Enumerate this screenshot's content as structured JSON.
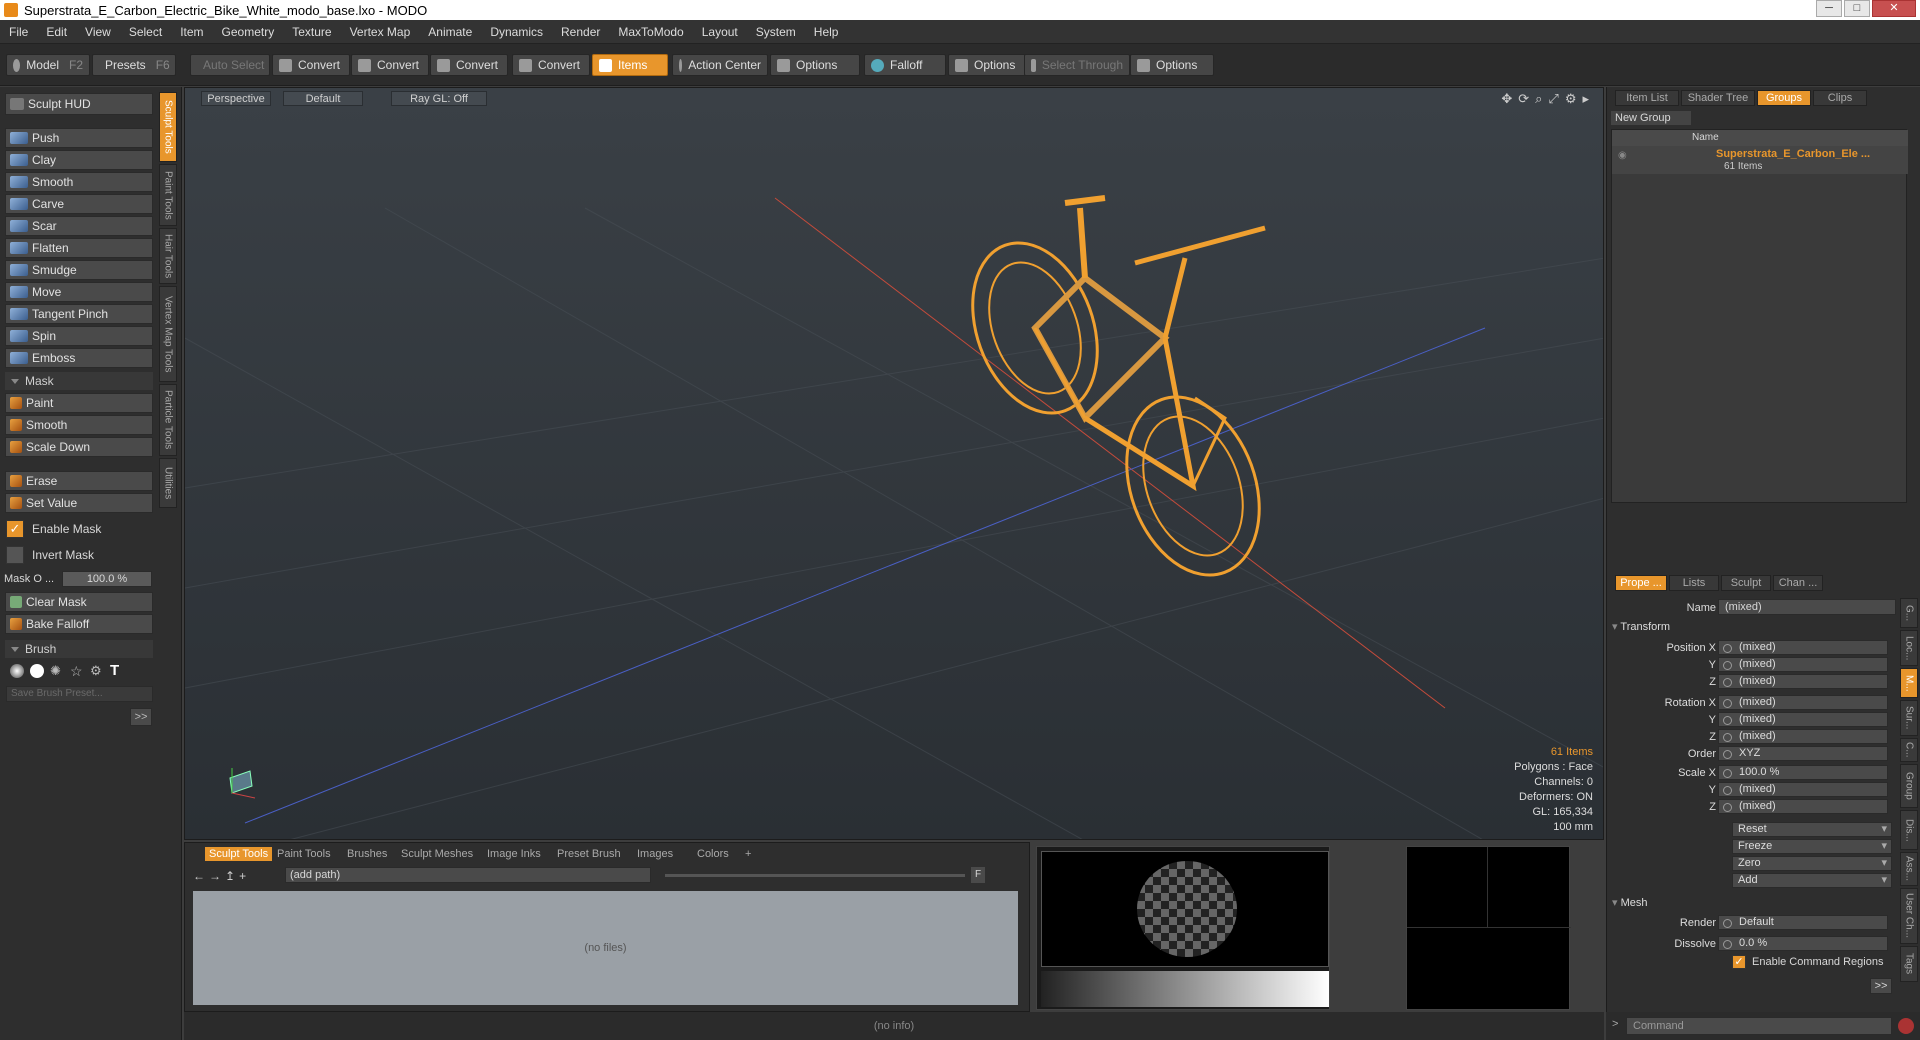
{
  "window": {
    "title": "Superstrata_E_Carbon_Electric_Bike_White_modo_base.lxo - MODO",
    "min": "─",
    "max": "□",
    "close": "✕"
  },
  "menu": [
    "File",
    "Edit",
    "View",
    "Select",
    "Item",
    "Geometry",
    "Texture",
    "Vertex Map",
    "Animate",
    "Dynamics",
    "Render",
    "MaxToModo",
    "Layout",
    "System",
    "Help"
  ],
  "toolbar": {
    "model": "Model",
    "model_key": "F2",
    "presets": "Presets",
    "presets_key": "F6",
    "auto_select": "Auto Select",
    "convert1": "Convert",
    "convert2": "Convert",
    "convert3": "Convert",
    "convert4": "Convert",
    "items": "Items",
    "action_center": "Action Center",
    "options1": "Options",
    "falloff": "Falloff",
    "options2": "Options",
    "select_through": "Select Through",
    "options3": "Options"
  },
  "left": {
    "sculpt_hud": "Sculpt HUD",
    "tools": [
      "Push",
      "Clay",
      "Smooth",
      "Carve",
      "Scar",
      "Flatten",
      "Smudge",
      "Move",
      "Tangent Pinch",
      "Spin",
      "Emboss"
    ],
    "mask_head": "Mask",
    "mask_tools": [
      "Paint",
      "Smooth",
      "Scale Down"
    ],
    "erase": "Erase",
    "set_value": "Set Value",
    "enable_mask": "Enable Mask",
    "invert_mask": "Invert Mask",
    "mask_opacity_label": "Mask O ...",
    "mask_opacity": "100.0 %",
    "clear_mask": "Clear Mask",
    "bake_falloff": "Bake Falloff",
    "brush_head": "Brush",
    "save_brush": "Save Brush Preset...",
    "more": ">>"
  },
  "vtabs": [
    "Sculpt Tools",
    "Paint Tools",
    "Hair Tools",
    "Vertex Map Tools",
    "Particle Tools",
    "Utilities"
  ],
  "viewport": {
    "perspective": "Perspective",
    "default": "Default",
    "raygl": "Ray GL: Off",
    "stats": {
      "items": "61 Items",
      "polygons": "Polygons : Face",
      "channels": "Channels: 0",
      "deformers": "Deformers: ON",
      "gl": "GL: 165,334",
      "scale": "100 mm"
    }
  },
  "right": {
    "tabs": [
      "Item List",
      "Shader Tree",
      "Groups",
      "Clips"
    ],
    "new_group": "New Group",
    "col_name": "Name",
    "group_name": "Superstrata_E_Carbon_Ele ...",
    "group_count": "61 Items",
    "prop_tabs": [
      "Prope ...",
      "Lists",
      "Sculpt",
      "Chan ..."
    ],
    "name_label": "Name",
    "name_value": "(mixed)",
    "transform": "Transform",
    "position_x": "Position X",
    "rotation_x": "Rotation X",
    "scale_x": "Scale X",
    "y": "Y",
    "z": "Z",
    "order": "Order",
    "order_value": "XYZ",
    "mixed": "(mixed)",
    "scale_val": "100.0 %",
    "reset": "Reset",
    "freeze": "Freeze",
    "zero": "Zero",
    "add": "Add",
    "mesh": "Mesh",
    "render_label": "Render",
    "render_value": "Default",
    "dissolve_label": "Dissolve",
    "dissolve_value": "0.0 %",
    "enable_cmd": "Enable Command Regions",
    "more": ">>",
    "side_tabs": [
      "G...",
      "Loc...",
      "M...",
      "Sur...",
      "C...",
      "Group",
      "Dis...",
      "Ass...",
      "User Ch...",
      "Tags"
    ],
    "command": "Command"
  },
  "bottom": {
    "tabs": [
      "Sculpt Tools",
      "Paint Tools",
      "Brushes",
      "Sculpt Meshes",
      "Image Inks",
      "Preset Brush",
      "Images",
      "Colors"
    ],
    "path": "(add path)",
    "nofiles": "(no files)",
    "f": "F"
  },
  "status": "(no info)",
  "colors": {
    "accent": "#e8962c",
    "wire": "#f0a030"
  }
}
